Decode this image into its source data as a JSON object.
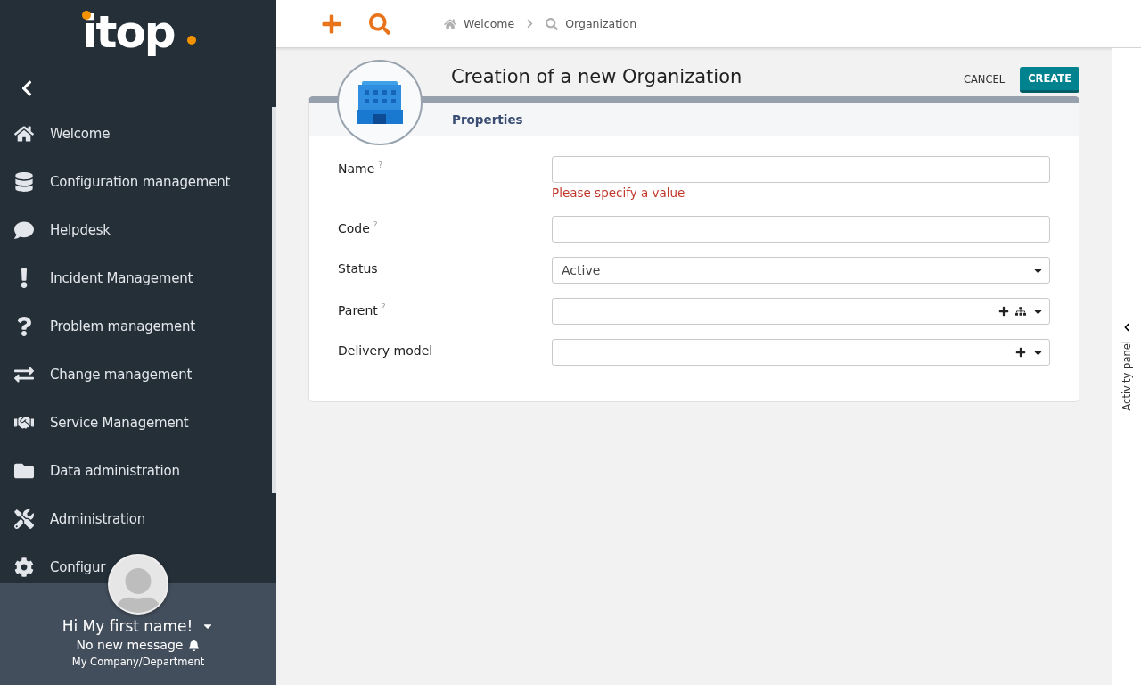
{
  "sidebar": {
    "logo": "itop",
    "items": [
      {
        "label": "Welcome",
        "kind": "home"
      },
      {
        "label": "Configuration management",
        "kind": "database"
      },
      {
        "label": "Helpdesk",
        "kind": "comment"
      },
      {
        "label": "Incident Management",
        "kind": "exclamation"
      },
      {
        "label": "Problem management",
        "kind": "question"
      },
      {
        "label": "Change management",
        "kind": "exchange"
      },
      {
        "label": "Service Management",
        "kind": "handshake"
      },
      {
        "label": "Data administration",
        "kind": "folder"
      },
      {
        "label": "Administration",
        "kind": "tools"
      },
      {
        "label": "Configur",
        "kind": "cog"
      }
    ],
    "user": {
      "greeting": "Hi My first name!",
      "messages": "No new message",
      "organization": "My Company/Department"
    }
  },
  "breadcrumbs": [
    {
      "label": "Welcome",
      "kind": "home"
    },
    {
      "label": "Organization",
      "kind": "search"
    }
  ],
  "form": {
    "title": "Creation of a new Organization",
    "buttons": [
      {
        "label": "CANCEL",
        "kind": "secondary"
      },
      {
        "label": "CREATE",
        "kind": "primary"
      }
    ],
    "tab": "Properties",
    "fields": [
      {
        "label": "Name",
        "hint_mark": "?",
        "kind": "text",
        "error": "Please specify a value"
      },
      {
        "label": "Code",
        "hint_mark": "?",
        "kind": "text"
      },
      {
        "label": "Status",
        "kind": "select",
        "value": "Active"
      },
      {
        "label": "Parent",
        "hint_mark": "?",
        "kind": "external",
        "hierarchy": true
      },
      {
        "label": "Delivery model",
        "kind": "external",
        "hierarchy": false
      }
    ]
  },
  "activity_panel": {
    "label": "Activity panel"
  }
}
